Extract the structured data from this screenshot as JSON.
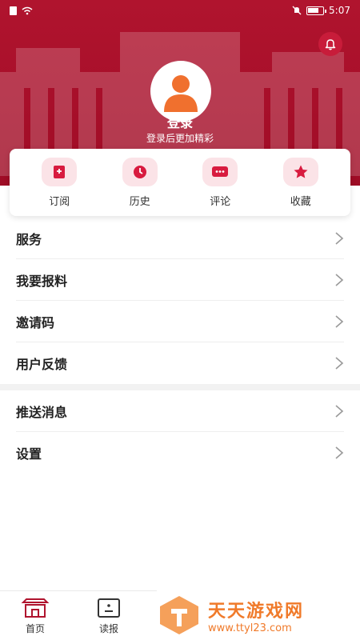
{
  "status_bar": {
    "time": "5:07"
  },
  "header": {
    "login_title": "登录",
    "login_subtitle": "登录后更加精彩",
    "brand_color": "#a80f2a"
  },
  "quick_actions": [
    {
      "label": "订阅",
      "icon": "bookmark-plus-icon"
    },
    {
      "label": "历史",
      "icon": "clock-icon"
    },
    {
      "label": "评论",
      "icon": "comment-icon"
    },
    {
      "label": "收藏",
      "icon": "star-icon"
    }
  ],
  "menu": {
    "group1": [
      {
        "label": "服务"
      },
      {
        "label": "我要报料"
      },
      {
        "label": "邀请码"
      },
      {
        "label": "用户反馈"
      }
    ],
    "group2": [
      {
        "label": "推送消息"
      },
      {
        "label": "设置"
      }
    ]
  },
  "bottom_nav": [
    {
      "label": "首页",
      "icon": "home-icon"
    },
    {
      "label": "读报",
      "icon": "newspaper-icon"
    }
  ],
  "watermark": {
    "title": "天天游戏网",
    "url": "www.ttyl23.com"
  }
}
